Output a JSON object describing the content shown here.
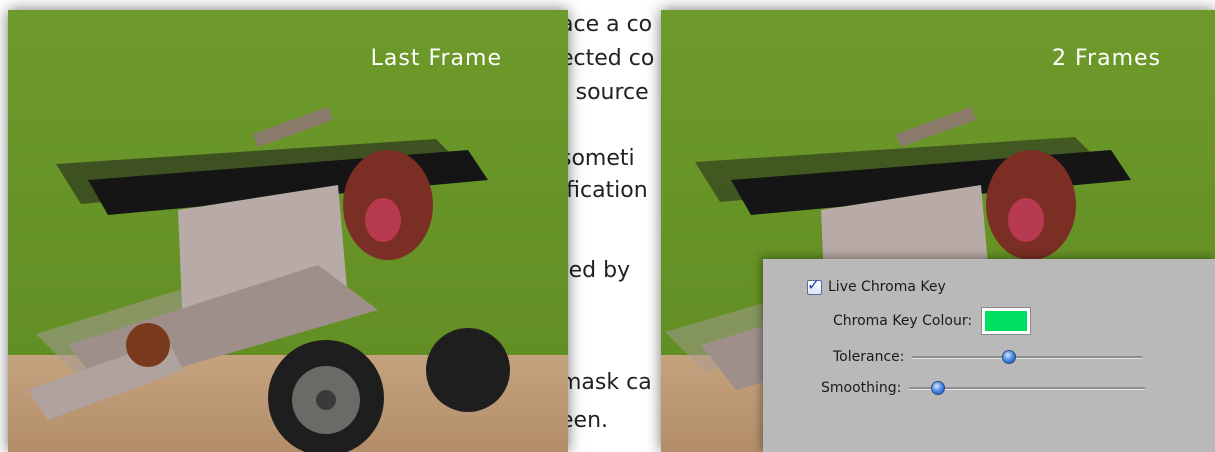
{
  "background_text": {
    "line1": "ace a co",
    "line2": "ected co",
    "line3": "t source",
    "line4": "someti",
    "line5": "ification",
    "line6": "ted by",
    "line7": "mask ca",
    "line8": "een."
  },
  "frames": {
    "left_label": "Last Frame",
    "right_label": "2 Frames"
  },
  "chroma_panel": {
    "live_chroma_key_label": "Live Chroma Key",
    "live_chroma_key_checked": true,
    "chroma_key_colour_label": "Chroma Key Colour:",
    "chroma_key_colour": "#00e060",
    "tolerance_label": "Tolerance:",
    "tolerance_fraction": 0.42,
    "smoothing_label": "Smoothing:",
    "smoothing_fraction": 0.12
  },
  "colors": {
    "green_screen": "#6f9b2c",
    "floor": "#c8a683",
    "panel_bg": "#b9b9b9"
  }
}
